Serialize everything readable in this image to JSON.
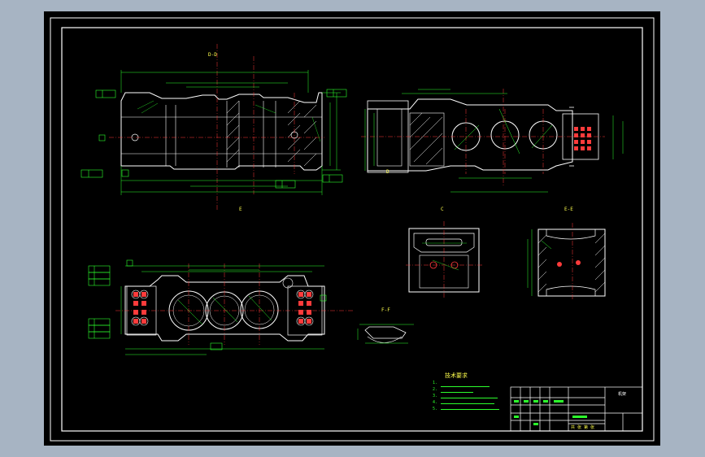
{
  "drawing": {
    "section_labels": {
      "view_c": "C",
      "view_ee": "E-E",
      "view_ff": "F-F",
      "datum_d": "D"
    },
    "tech_requirements_title": "技术要求",
    "tech_requirements": [
      "1.",
      "2.",
      "3.",
      "4.",
      "5."
    ],
    "title_block": {
      "part_name": "机架",
      "scale_row": "共 张 第 张"
    },
    "colors": {
      "sheet": "#000000",
      "frame": "#ffffff",
      "outline": "#ffffff",
      "dimension": "#2cff2c",
      "centerline": "#ff3b3b",
      "hatch": "#ffffff",
      "annotation": "#ffff4d",
      "background": "#a7b4c3"
    }
  }
}
